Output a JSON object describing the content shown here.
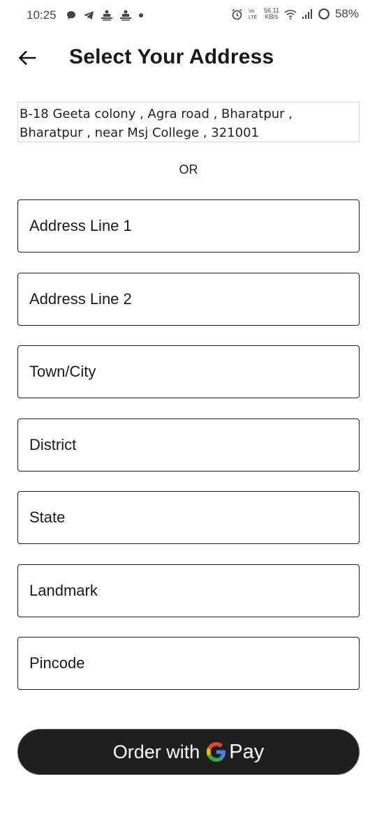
{
  "status_bar": {
    "time": "10:25",
    "net_speed_value": "56.11",
    "net_speed_unit": "KB/s",
    "battery_percent": "58%",
    "left_icons": [
      "chat-icon",
      "telegram-icon",
      "notification-icon",
      "notification-icon",
      "dot-icon"
    ],
    "right_icons": [
      "alarm-icon",
      "volte-icon",
      "wifi-icon",
      "signal-icon",
      "battery-icon"
    ]
  },
  "header": {
    "title": "Select Your Address",
    "back_icon": "arrow-left-icon"
  },
  "saved_address": {
    "text": "B-18 Geeta colony , Agra road , Bharatpur , Bharatpur , near Msj College , 321001"
  },
  "divider_text": "OR",
  "form": {
    "fields": [
      {
        "placeholder": "Address Line 1",
        "value": ""
      },
      {
        "placeholder": "Address Line 2",
        "value": ""
      },
      {
        "placeholder": "Town/City",
        "value": ""
      },
      {
        "placeholder": "District",
        "value": ""
      },
      {
        "placeholder": "State",
        "value": ""
      },
      {
        "placeholder": "Landmark",
        "value": ""
      },
      {
        "placeholder": "Pincode",
        "value": ""
      }
    ]
  },
  "order_button": {
    "label": "Order with",
    "brand_letter": "G",
    "brand_word": "Pay",
    "colors": {
      "background": "#1f1f1f",
      "text": "#ffffff",
      "g_blue": "#4285F4",
      "g_red": "#EA4335",
      "g_yellow": "#FBBC05",
      "g_green": "#34A853"
    }
  }
}
